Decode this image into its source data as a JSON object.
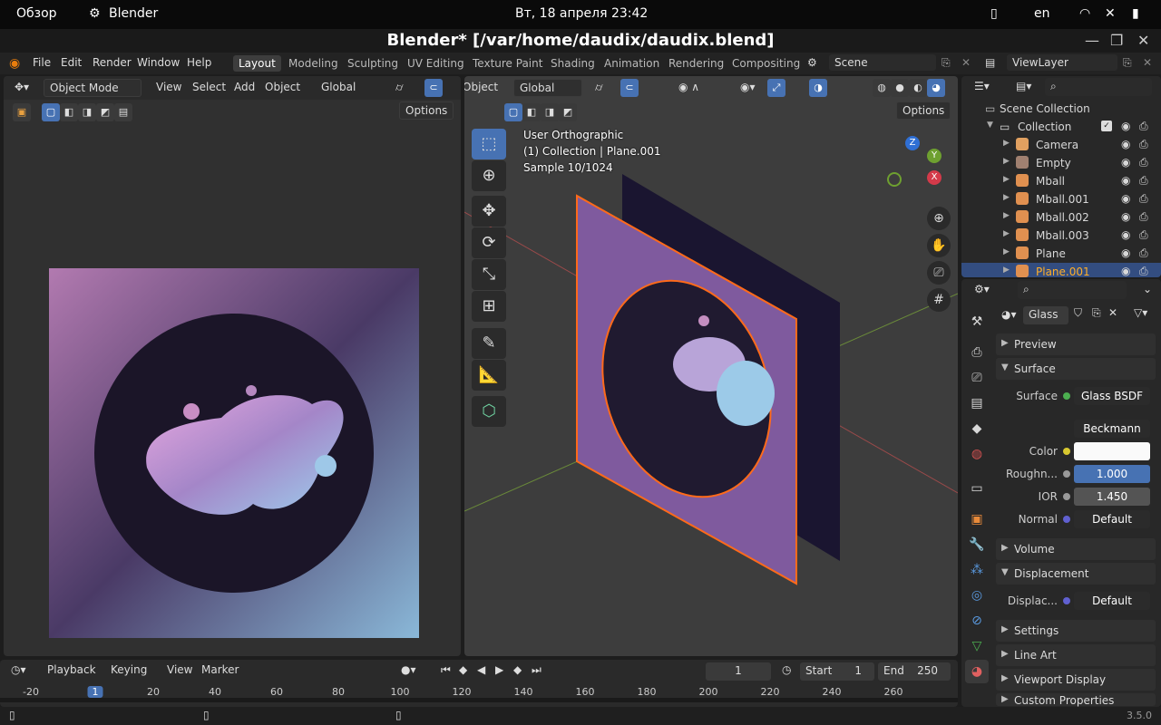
{
  "gnome": {
    "overview": "Обзор",
    "app": "Blender",
    "datetime": "Вт, 18 апреля  23:42",
    "lang": "en"
  },
  "window": {
    "title": "Blender* [/var/home/daudix/daudix.blend]"
  },
  "menu": [
    "File",
    "Edit",
    "Render",
    "Window",
    "Help"
  ],
  "workspaces": [
    "Layout",
    "Modeling",
    "Sculpting",
    "UV Editing",
    "Texture Paint",
    "Shading",
    "Animation",
    "Rendering",
    "Compositing"
  ],
  "active_workspace": "Layout",
  "scene": "Scene",
  "view_layer": "ViewLayer",
  "left_editor": {
    "mode": "Object Mode",
    "menus": [
      "View",
      "Select",
      "Add",
      "Object"
    ],
    "orientation": "Global",
    "options": "Options"
  },
  "viewport": {
    "object_menu": "Object",
    "orientation": "Global",
    "options": "Options",
    "overlay_lines": [
      "User Orthographic",
      "(1) Collection | Plane.001",
      "Sample 10/1024"
    ],
    "gizmo": {
      "z": "Z",
      "y": "Y",
      "x": "X"
    }
  },
  "outliner": {
    "root": "Scene Collection",
    "collection": "Collection",
    "items": [
      {
        "name": "Camera",
        "color": "#e0a060"
      },
      {
        "name": "Empty",
        "color": "#a08070"
      },
      {
        "name": "Mball",
        "color": "#e09050"
      },
      {
        "name": "Mball.001",
        "color": "#e09050"
      },
      {
        "name": "Mball.002",
        "color": "#e09050"
      },
      {
        "name": "Mball.003",
        "color": "#e09050"
      },
      {
        "name": "Plane",
        "color": "#e09050"
      },
      {
        "name": "Plane.001",
        "color": "#e09050"
      }
    ]
  },
  "properties": {
    "material": "Glass",
    "panels": {
      "preview": "Preview",
      "surface": "Surface",
      "volume": "Volume",
      "displacement": "Displacement",
      "settings": "Settings",
      "lineart": "Line Art",
      "viewport_display": "Viewport Display",
      "custom": "Custom Properties"
    },
    "surface_label": "Surface",
    "surface_value": "Glass BSDF",
    "distribution": "Beckmann",
    "color_label": "Color",
    "roughness_label": "Roughn...",
    "roughness_value": "1.000",
    "ior_label": "IOR",
    "ior_value": "1.450",
    "normal_label": "Normal",
    "normal_value": "Default",
    "displacement_label": "Displac...",
    "displacement_value": "Default"
  },
  "timeline": {
    "menus": [
      "Playback",
      "Keying",
      "View",
      "Marker"
    ],
    "current_frame": "1",
    "start_label": "Start",
    "start": "1",
    "end_label": "End",
    "end": "250",
    "ticks": [
      "-20",
      "1",
      "20",
      "40",
      "60",
      "80",
      "100",
      "120",
      "140",
      "160",
      "180",
      "200",
      "220",
      "240",
      "260"
    ]
  },
  "status": {
    "version": "3.5.0"
  }
}
